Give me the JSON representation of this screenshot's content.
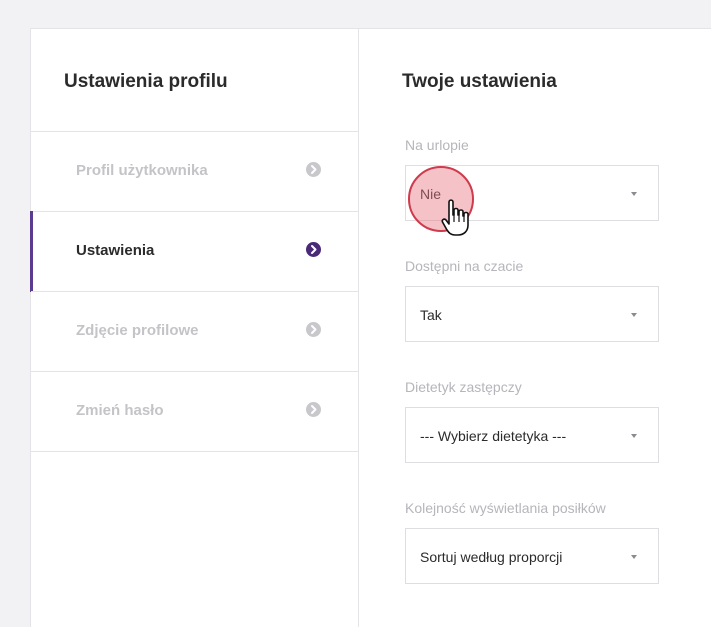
{
  "sidebar": {
    "title": "Ustawienia profilu",
    "items": [
      {
        "label": "Profil użytkownika",
        "active": false
      },
      {
        "label": "Ustawienia",
        "active": true
      },
      {
        "label": "Zdjęcie profilowe",
        "active": false
      },
      {
        "label": "Zmień hasło",
        "active": false
      }
    ]
  },
  "main": {
    "title": "Twoje ustawienia",
    "fields": [
      {
        "label": "Na urlopie",
        "value": "Nie"
      },
      {
        "label": "Dostępni na czacie",
        "value": "Tak"
      },
      {
        "label": "Dietetyk zastępczy",
        "value": "--- Wybierz dietetyka ---"
      },
      {
        "label": "Kolejność wyświetlania posiłków",
        "value": "Sortuj według proporcji"
      }
    ]
  },
  "icons": {
    "chevron": "chevron-right-circle-icon",
    "caret": "caret-down-icon",
    "cursor": "hand-pointer-icon"
  },
  "colors": {
    "accent": "#5b3a8f",
    "active_chevron": "#4a2a78",
    "inactive_text": "#c4c4c8",
    "click_indicator": "#cf3a4c"
  }
}
